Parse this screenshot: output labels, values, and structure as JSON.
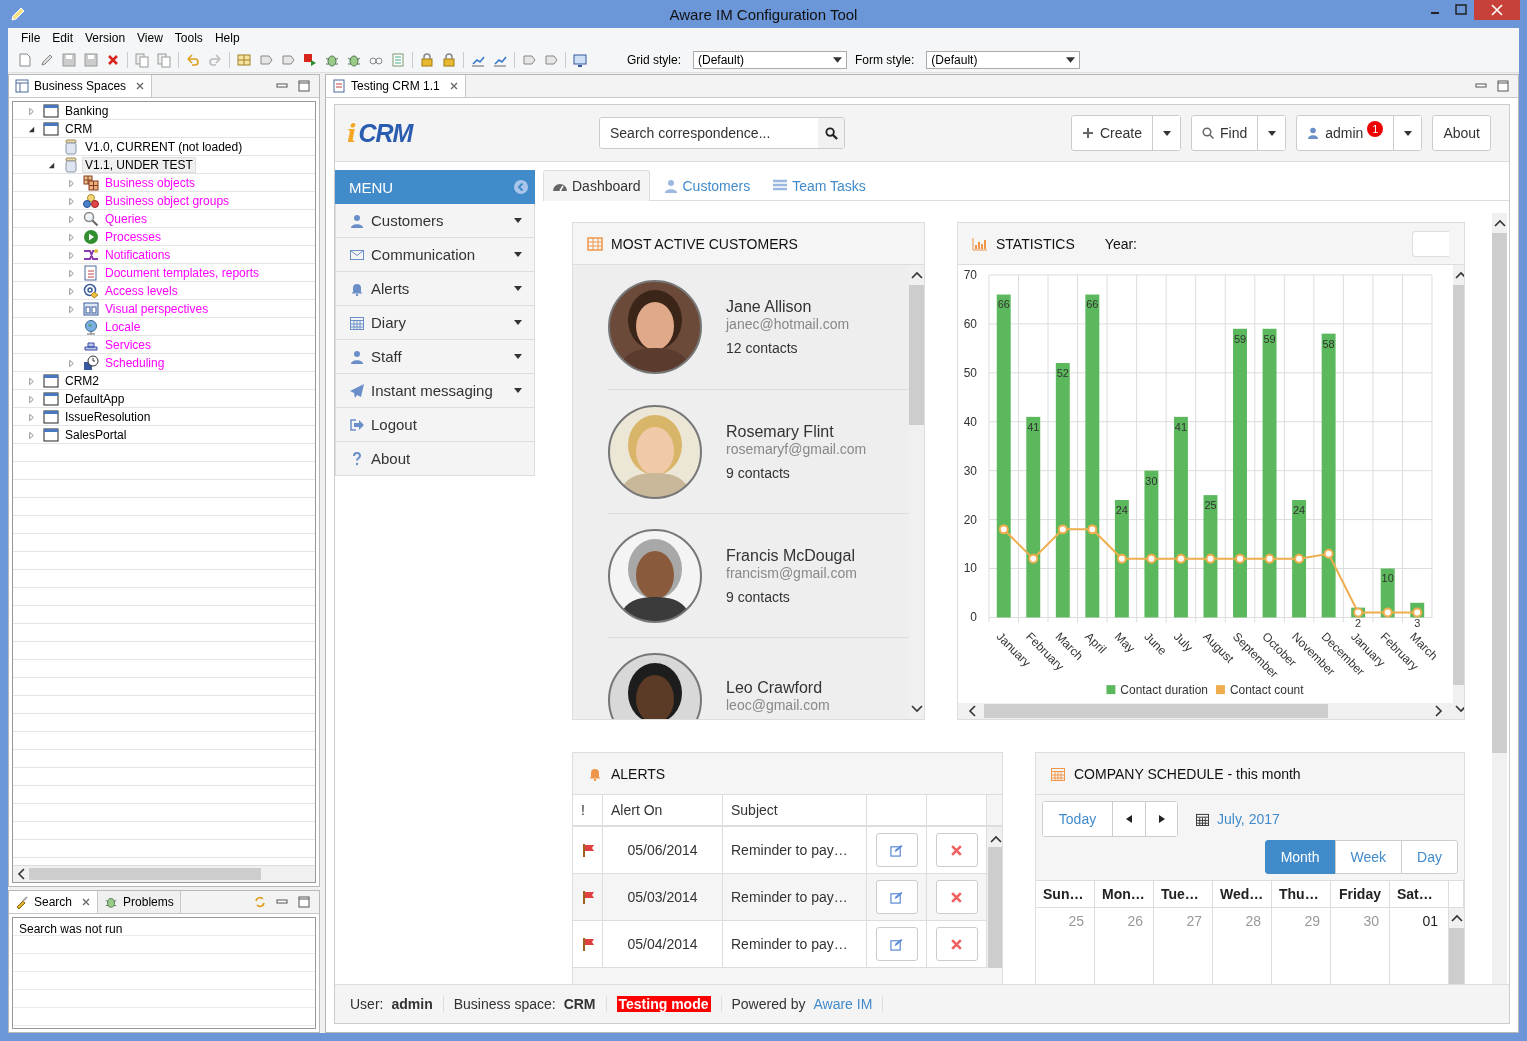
{
  "window": {
    "title": "Aware IM Configuration Tool"
  },
  "menu_bar": [
    "File",
    "Edit",
    "Version",
    "View",
    "Tools",
    "Help"
  ],
  "toolbar": {
    "grid_style": {
      "label": "Grid style:",
      "value": "(Default)"
    },
    "form_style": {
      "label": "Form style:",
      "value": "(Default)"
    }
  },
  "business_spaces": {
    "title": "Business Spaces",
    "tree": [
      {
        "label": "Banking",
        "kind": "space",
        "expanded": false,
        "selected": false
      },
      {
        "label": "CRM",
        "kind": "space",
        "expanded": true,
        "selected": false,
        "children": [
          {
            "label": "V1.0, CURRENT (not loaded)",
            "kind": "version",
            "selected": false
          },
          {
            "label": "V1.1, UNDER TEST",
            "kind": "version",
            "expanded": true,
            "selected": true,
            "children": [
              {
                "label": "Business objects",
                "kind": "objects",
                "expanded": false,
                "selected": false
              },
              {
                "label": "Business object groups",
                "kind": "groups",
                "expanded": false,
                "selected": false
              },
              {
                "label": "Queries",
                "kind": "queries",
                "expanded": false,
                "selected": false
              },
              {
                "label": "Processes",
                "kind": "processes",
                "expanded": false,
                "selected": false
              },
              {
                "label": "Notifications",
                "kind": "notifications",
                "expanded": false,
                "selected": false
              },
              {
                "label": "Document templates, reports",
                "kind": "documents",
                "expanded": false,
                "selected": false
              },
              {
                "label": "Access levels",
                "kind": "access",
                "expanded": false,
                "selected": false
              },
              {
                "label": "Visual perspectives",
                "kind": "perspectives",
                "expanded": false,
                "selected": false
              },
              {
                "label": "Locale",
                "kind": "locale",
                "selected": false
              },
              {
                "label": "Services",
                "kind": "services",
                "selected": false
              },
              {
                "label": "Scheduling",
                "kind": "scheduling",
                "expanded": false,
                "selected": false
              }
            ]
          }
        ]
      },
      {
        "label": "CRM2",
        "kind": "space",
        "expanded": false,
        "selected": false
      },
      {
        "label": "DefaultApp",
        "kind": "space",
        "expanded": false,
        "selected": false
      },
      {
        "label": "IssueResolution",
        "kind": "space",
        "expanded": false,
        "selected": false
      },
      {
        "label": "SalesPortal",
        "kind": "space",
        "expanded": false,
        "selected": false
      }
    ]
  },
  "search_panel": {
    "tabs": [
      {
        "label": "Search",
        "selected": true
      },
      {
        "label": "Problems",
        "selected": false
      }
    ],
    "message": "Search was not run"
  },
  "editor_tab": {
    "title": "Testing CRM 1.1"
  },
  "app": {
    "logo": {
      "mark": "i",
      "text": "CRM"
    },
    "search": {
      "placeholder": "Search correspondence..."
    },
    "header_buttons": [
      {
        "label": "Create",
        "kind": "split"
      },
      {
        "label": "Find",
        "kind": "split"
      },
      {
        "label": "admin",
        "kind": "split",
        "badge": "1"
      },
      {
        "label": "About",
        "kind": "plain"
      }
    ],
    "side_menu": {
      "title": "MENU",
      "items": [
        {
          "label": "Customers",
          "submenu": true
        },
        {
          "label": "Communication",
          "submenu": true
        },
        {
          "label": "Alerts",
          "submenu": true
        },
        {
          "label": "Diary",
          "submenu": true
        },
        {
          "label": "Staff",
          "submenu": true
        },
        {
          "label": "Instant messaging",
          "submenu": true
        },
        {
          "label": "Logout",
          "submenu": false
        },
        {
          "label": "About",
          "submenu": false
        }
      ]
    },
    "tabs": [
      {
        "label": "Dashboard",
        "selected": true
      },
      {
        "label": "Customers",
        "selected": false
      },
      {
        "label": "Team Tasks",
        "selected": false
      }
    ],
    "status_bar": {
      "user_label": "User:",
      "user": "admin",
      "space_label": "Business space:",
      "space": "CRM",
      "mode": "Testing mode",
      "powered_label": "Powered by",
      "powered_link": "Aware IM"
    }
  },
  "dashboard": {
    "customers": {
      "title": "MOST ACTIVE CUSTOMERS",
      "items": [
        {
          "name": "Jane Allison",
          "email": "janec@hotmail.com",
          "contacts": "12 contacts"
        },
        {
          "name": "Rosemary Flint",
          "email": "rosemaryf@gmail.com",
          "contacts": "9 contacts"
        },
        {
          "name": "Francis McDougal",
          "email": "francism@gmail.com",
          "contacts": "9 contacts"
        },
        {
          "name": "Leo Crawford",
          "email": "leoc@gmail.com"
        }
      ]
    },
    "statistics": {
      "title": "STATISTICS",
      "year_label": "Year:",
      "chart_data": {
        "type": "bar",
        "categories": [
          "January",
          "February",
          "March",
          "April",
          "May",
          "June",
          "July",
          "August",
          "September",
          "October",
          "November",
          "December",
          "January",
          "February",
          "March"
        ],
        "series": [
          {
            "name": "Contact duration",
            "type": "bar",
            "color": "#5cb85c",
            "values": [
              66,
              41,
              52,
              66,
              24,
              30,
              41,
              25,
              59,
              59,
              24,
              58,
              2,
              10,
              3
            ],
            "value_labels": [
              "66",
              "41",
              "52",
              "66",
              "24",
              "30",
              "41",
              "25",
              "59",
              "59",
              "24",
              "58",
              "2",
              "10",
              "3"
            ]
          },
          {
            "name": "Contact count",
            "type": "line",
            "color": "#f0ad4e",
            "marker": "circle",
            "values": [
              18,
              12,
              18,
              18,
              12,
              12,
              12,
              12,
              12,
              12,
              12,
              13,
              1,
              1,
              1
            ]
          }
        ],
        "ylim": [
          0,
          70
        ],
        "yticks": [
          0,
          10,
          20,
          30,
          40,
          50,
          60,
          70
        ],
        "grid": true,
        "legend": "bottom"
      }
    },
    "alerts": {
      "title": "ALERTS",
      "columns": [
        "!",
        "Alert On",
        "Subject"
      ],
      "rows": [
        {
          "date": "05/06/2014",
          "subject": "Reminder to pay…"
        },
        {
          "date": "05/03/2014",
          "subject": "Reminder to pay…"
        },
        {
          "date": "05/04/2014",
          "subject": "Reminder to pay…"
        }
      ]
    },
    "schedule": {
      "title": "COMPANY SCHEDULE - this month",
      "today": "Today",
      "period": "July, 2017",
      "views": [
        {
          "label": "Month",
          "selected": true
        },
        {
          "label": "Week",
          "selected": false
        },
        {
          "label": "Day",
          "selected": false
        }
      ],
      "weekdays": [
        "Sun…",
        "Mon…",
        "Tue…",
        "Wed…",
        "Thu…",
        "Friday",
        "Sat…"
      ],
      "dates": [
        {
          "day": "25",
          "other_month": true
        },
        {
          "day": "26",
          "other_month": true
        },
        {
          "day": "27",
          "other_month": true
        },
        {
          "day": "28",
          "other_month": true
        },
        {
          "day": "29",
          "other_month": true
        },
        {
          "day": "30",
          "other_month": true
        },
        {
          "day": "01",
          "other_month": false
        }
      ]
    }
  }
}
